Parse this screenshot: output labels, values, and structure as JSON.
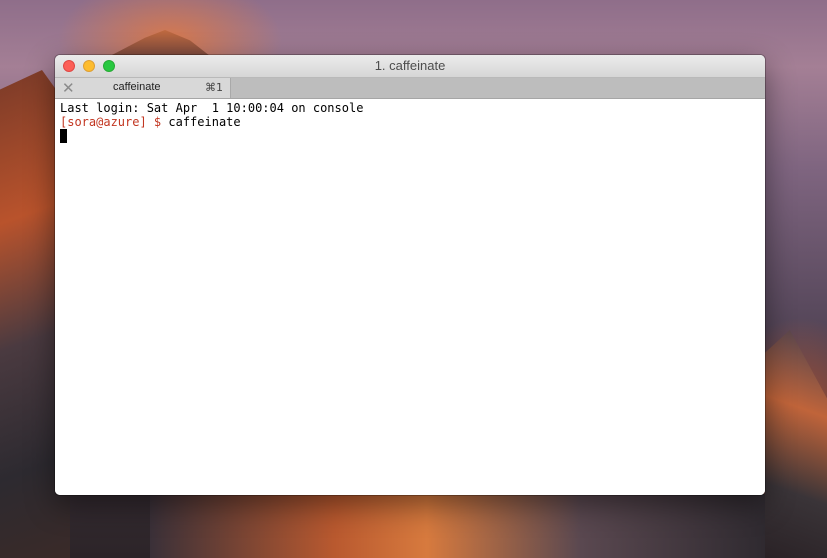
{
  "window": {
    "title": "1. caffeinate"
  },
  "tab": {
    "close_glyph": "✕",
    "label": "caffeinate",
    "shortcut": "⌘1"
  },
  "terminal": {
    "last_login": "Last login: Sat Apr  1 10:00:04 on console",
    "prompt": "[sora@azure] $",
    "command": " caffeinate"
  },
  "colors": {
    "prompt": "#c23621",
    "close_button": "#fc5f57",
    "minimize_button": "#fdbc2e",
    "zoom_button": "#28c840"
  },
  "icons": [
    "close-icon",
    "minimize-icon",
    "zoom-icon",
    "tab-close-icon"
  ]
}
